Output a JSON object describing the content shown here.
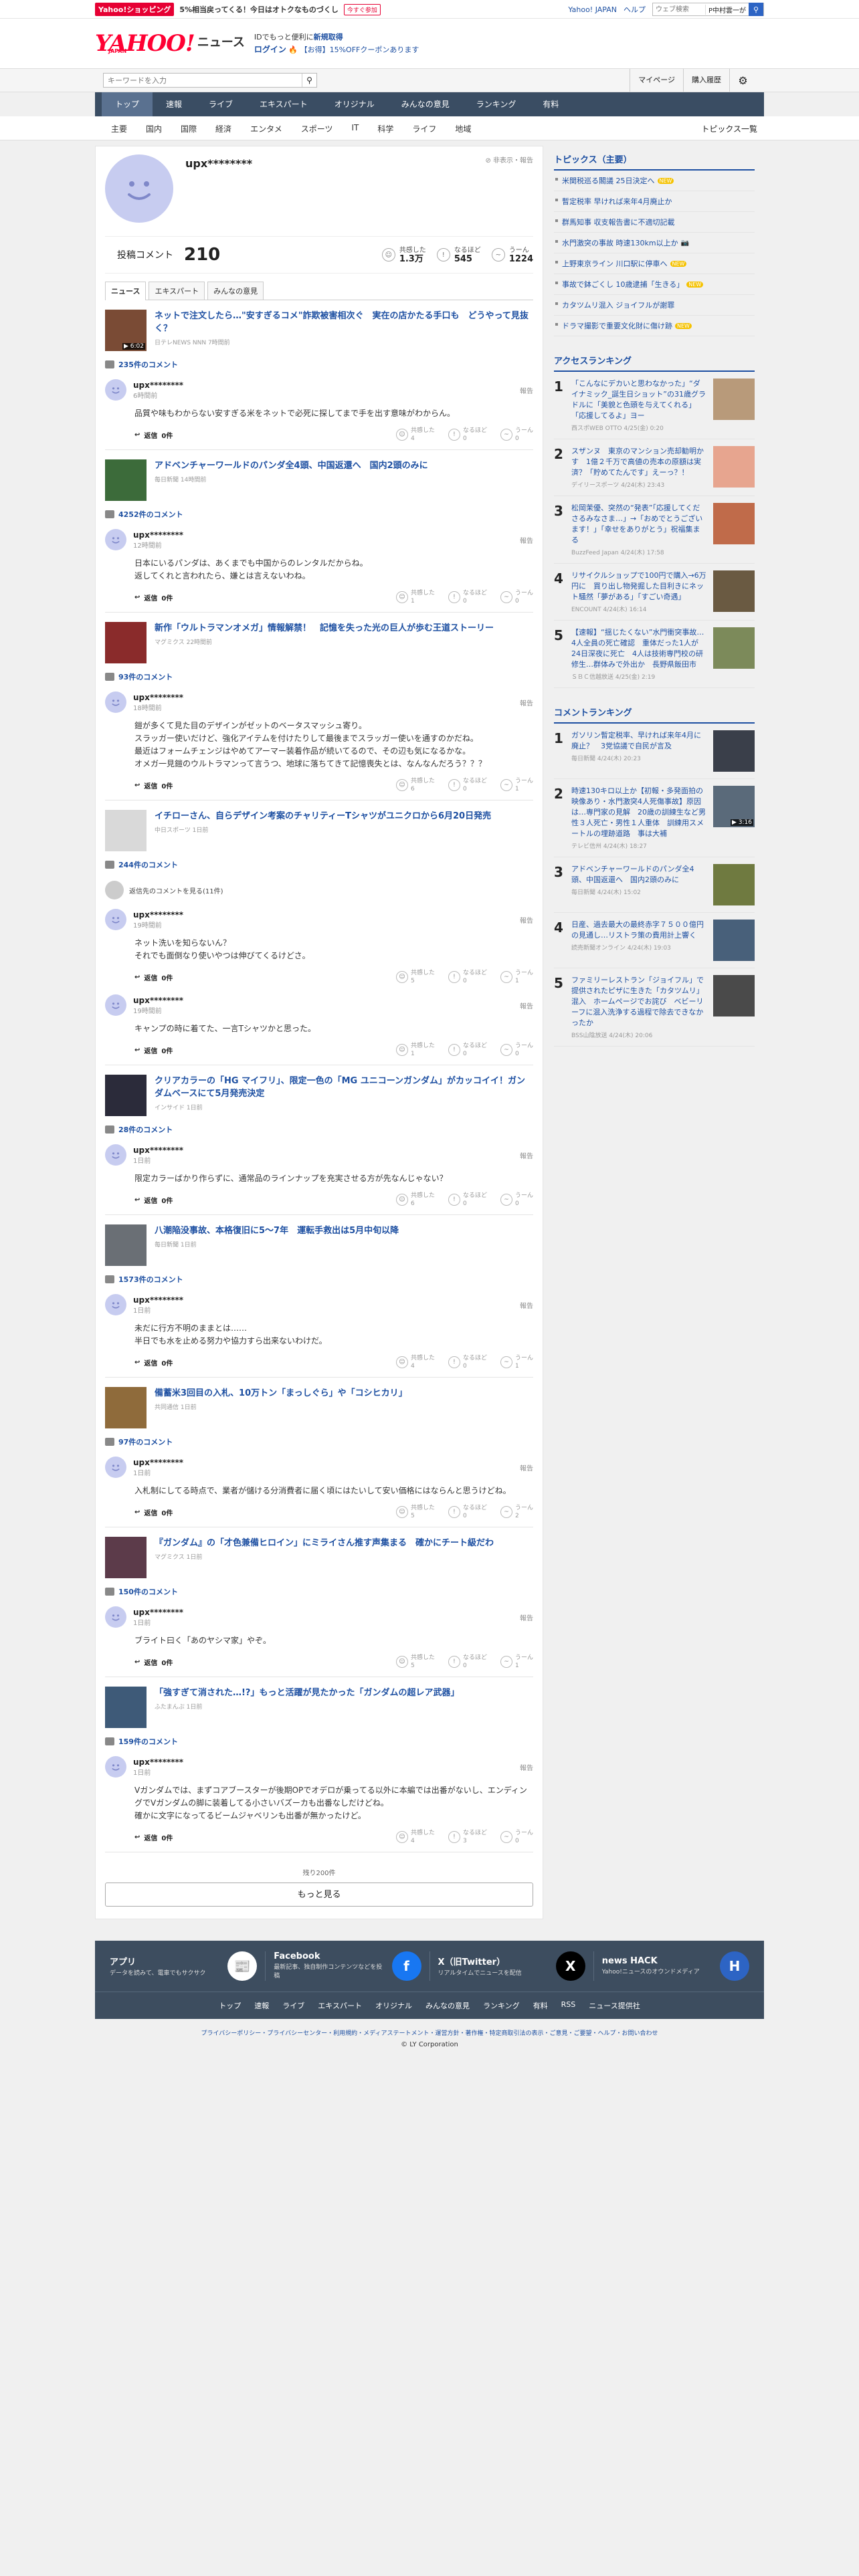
{
  "topbar": {
    "shop_badge": "Yahoo!ショッピング",
    "promo": "5%相当戻ってくる！今日はオトクなものづくし",
    "promo_button": "今すぐ参加",
    "yahoo_japan": "Yahoo! JAPAN",
    "help": "ヘルプ",
    "web_search_placeholder": "ウェブ検索",
    "web_search_chip": "P中村雲一が",
    "web_search_button": "検索"
  },
  "header": {
    "logo_text": "YAHOO!",
    "logo_sub": "JAPAN",
    "logo_news": "ニュース",
    "line1_prefix": "IDでもっと便利に",
    "line1_link": "新規取得",
    "line2_login": "ログイン",
    "line2_coupon": "【お得】15%OFFクーポンあります"
  },
  "searchrow": {
    "placeholder": "キーワードを入力",
    "mypage": "マイページ",
    "history": "購入履歴"
  },
  "mainnav": [
    "トップ",
    "速報",
    "ライブ",
    "エキスパート",
    "オリジナル",
    "みんなの意見",
    "ランキング",
    "有料"
  ],
  "subnav": [
    "主要",
    "国内",
    "国際",
    "経済",
    "エンタメ",
    "スポーツ",
    "IT",
    "科学",
    "ライフ",
    "地域"
  ],
  "subnav_right": "トピックス一覧",
  "profile": {
    "name": "upx********",
    "report": "非表示・報告",
    "post_label": "投稿コメント",
    "post_count": "210",
    "reactions": [
      {
        "label": "共感した",
        "value": "1.3万"
      },
      {
        "label": "なるほど",
        "value": "545"
      },
      {
        "label": "うーん",
        "value": "1224"
      }
    ],
    "tabs": [
      "ニュース",
      "エキスパート",
      "みんなの意見"
    ]
  },
  "articles": [
    {
      "title": "ネットで注文したら…\"安すぎるコメ\"詐欺被害相次ぐ　実在の店かたる手口も　どうやって見抜く？",
      "source": "日テレNEWS NNN 7時間前",
      "duration": "▶ 6:02",
      "comment_count": "235件のコメント",
      "comments": [
        {
          "user": "upx********",
          "time": "6時間前",
          "body": "品質や味もわからない安すぎる米をネットで必死に探してまで手を出す意味がわからん。",
          "votes": [
            "4",
            "0",
            "0"
          ]
        }
      ]
    },
    {
      "title": "アドベンチャーワールドのパンダ全4頭、中国返還へ　国内2頭のみに",
      "source": "毎日新聞 14時間前",
      "comment_count": "4252件のコメント",
      "comments": [
        {
          "user": "upx********",
          "time": "12時間前",
          "body": "日本にいるパンダは、あくまでも中国からのレンタルだからね。\n返してくれと言われたら、嫌とは言えないわね。",
          "votes": [
            "1",
            "0",
            "0"
          ]
        }
      ]
    },
    {
      "title": "新作「ウルトラマンオメガ」情報解禁！　記憶を失った光の巨人が歩む王道ストーリー",
      "source": "マグミクス 22時間前",
      "comment_count": "93件のコメント",
      "comments": [
        {
          "user": "upx********",
          "time": "18時間前",
          "body": "鎧が多くて見た目のデザインがゼットのベータスマッシュ寄り。\nスラッガー使いだけど、強化アイテムを付けたりして最後までスラッガー使いを通すのかだね。\n最近はフォームチェンジはやめてアーマー装着作品が続いてるので、その辺も気になるかな。\nオメガ一見鎧のウルトラマンって言うつ、地球に落ちてきて記憶喪失とは、なんなんだろう？？？",
          "votes": [
            "6",
            "0",
            "1"
          ]
        }
      ]
    },
    {
      "title": "イチローさん、自らデザイン考案のチャリティーTシャツがユニクロから6月20日発売",
      "source": "中日スポーツ 1日前",
      "comment_count": "244件のコメント",
      "hidden": "返信先のコメントを見る(11件)",
      "comments": [
        {
          "user": "upx********",
          "time": "19時間前",
          "body": "ネット洗いを知らないん？\nそれでも面倒なり使いやつは伸びてくるけどさ。",
          "votes": [
            "5",
            "0",
            "1"
          ]
        },
        {
          "user": "upx********",
          "time": "19時間前",
          "body": "キャンプの時に着てた、一言Tシャツかと思った。",
          "votes": [
            "1",
            "0",
            "0"
          ]
        }
      ]
    },
    {
      "title": "クリアカラーの「HG マイフリ」、限定一色の「MG ユニコーンガンダム」がカッコイイ！ガンダムベースにて5月発売決定",
      "source": "インサイド 1日前",
      "comment_count": "28件のコメント",
      "comments": [
        {
          "user": "upx********",
          "time": "1日前",
          "body": "限定カラーばかり作らずに、通常品のラインナップを充実させる方が先なんじゃない？",
          "votes": [
            "6",
            "0",
            "0"
          ]
        }
      ]
    },
    {
      "title": "八潮陥没事故、本格復旧に5～7年　運転手救出は5月中旬以降",
      "source": "毎日新聞 1日前",
      "comment_count": "1573件のコメント",
      "comments": [
        {
          "user": "upx********",
          "time": "1日前",
          "body": "未だに行方不明のままとは……\n半日でも水を止める努力や協力すら出来ないわけだ。",
          "votes": [
            "4",
            "0",
            "1"
          ]
        }
      ]
    },
    {
      "title": "備蓄米3回目の入札、10万トン「まっしぐら」や「コシヒカリ」",
      "source": "共同通信 1日前",
      "comment_count": "97件のコメント",
      "comments": [
        {
          "user": "upx********",
          "time": "1日前",
          "body": "入札制にしてる時点で、業者が儲ける分消費者に届く頃にはたいして安い価格にはならんと思うけどね。",
          "votes": [
            "5",
            "0",
            "2"
          ]
        }
      ]
    },
    {
      "title": "『ガンダム』の「才色兼備ヒロイン」にミライさん推す声集まる　確かにチート級だわ",
      "source": "マグミクス 1日前",
      "comment_count": "150件のコメント",
      "comments": [
        {
          "user": "upx********",
          "time": "1日前",
          "body": "ブライト曰く「あのヤシマ家」やぞ。",
          "votes": [
            "5",
            "0",
            "1"
          ]
        }
      ]
    },
    {
      "title": "「強すぎて消された…!?」もっと活躍が見たかった「ガンダムの超レア武器」",
      "source": "ふたまんぷ 1日前",
      "comment_count": "159件のコメント",
      "comments": [
        {
          "user": "upx********",
          "time": "1日前",
          "body": "Vガンダムでは、まずコアブースターが後期OPでオデロが乗ってる以外に本編では出番がないし、エンディングでVガンダムの脚に装着してる小さいバズーカも出番なしだけどね。\n確かに文字になってるビームジャベリンも出番が無かったけど。",
          "votes": [
            "4",
            "3",
            "0"
          ]
        }
      ]
    }
  ],
  "reply_label": "返信",
  "reply_count": "0件",
  "vote_labels": [
    "共感した",
    "なるほど",
    "うーん"
  ],
  "report_label": "報告",
  "remain": "残り200件",
  "more_button": "もっと見る",
  "sidebar": {
    "topics_title": "トピックス（主要）",
    "topics": [
      {
        "text": "米関税巡る閣議 25日決定へ",
        "new": "NEW"
      },
      {
        "text": "暫定税率 早ければ来年4月廃止か",
        "new": ""
      },
      {
        "text": "群馬知事 収支報告書に不適切記載",
        "new": ""
      },
      {
        "text": "水門激突の事故 時速130km以上か",
        "new": "",
        "cam": "📷"
      },
      {
        "text": "上野東京ライン 川口駅に停車へ",
        "new": "NEW"
      },
      {
        "text": "事故で鉢ごくし 10歳逮捕「生きる」",
        "new": "NEW"
      },
      {
        "text": "カタツムリ混入 ジョイフルが謝罪",
        "new": ""
      },
      {
        "text": "ドラマ撮影で重要文化財に傷け跡",
        "new": "NEW"
      }
    ],
    "access_title": "アクセスランキング",
    "access": [
      {
        "n": "1",
        "t": "「こんなにデカいと思わなかった」“ダイナミック_誕生日ショット”の31歳グラドルに「美貌と色頭を与えてくれる」「応援してるよ」ヨー",
        "s": "西スポWEB OTTO 4/25(金) 0:20"
      },
      {
        "n": "2",
        "t": "スザンヌ　東京のマンション売却勧明かす　1億２千万で高値の売本の原額は実済？「貯めてたんです」えーっ？！",
        "s": "デイリースポーツ 4/24(木) 23:43"
      },
      {
        "n": "3",
        "t": "松岡茉優、突然の“発表”「応援してくださるみなさま…」→「おめでとうございます！」「幸せをありがとう」祝福集まる",
        "s": "BuzzFeed Japan 4/24(木) 17:58"
      },
      {
        "n": "4",
        "t": "リサイクルショップで100円で購入→6万円に　買り出し物発掘した目利きにネット騒然「夢がある」「すごい奇遇」",
        "s": "ENCOUNT 4/24(木) 16:14"
      },
      {
        "n": "5",
        "t": "【速報】“揺じたくない”水門衝突事故…4人全員の死亡確認　重体だった1人が24日深夜に死亡　4人は技術専門校の研修生…群体みで外出か　長野県飯田市",
        "s": "ＳＢＣ信越放送 4/25(金) 2:19"
      }
    ],
    "comment_title": "コメントランキング",
    "comment_rank": [
      {
        "n": "1",
        "t": "ガソリン暫定税率、早ければ来年4月に廃止？　3党協議で自民が言及",
        "s": "毎日新聞 4/24(木) 20:23"
      },
      {
        "n": "2",
        "t": "時速130キロ以上か【初報・多発面拍の映像あり・水門激突4人死傷事故】原因は…専門家の見解　20歳の訓練生など男性３人死亡・男性１人重体　訓練用スメートルの埋跡道路　事は大補",
        "s": "テレビ信州 4/24(木) 18:27",
        "d": "▶ 3:16"
      },
      {
        "n": "3",
        "t": "アドベンチャーワールドのパンダ全4頭、中国返還へ　国内2頭のみに",
        "s": "毎日新聞 4/24(木) 15:02"
      },
      {
        "n": "4",
        "t": "日産、過去最大の最終赤字７５００億円の見通し…リストラ策の費用計上響く",
        "s": "読売新聞オンライン 4/24(木) 19:03"
      },
      {
        "n": "5",
        "t": "ファミリーレストラン「ジョイフル」で提供されたピザに生きた「カタツムリ」混入　ホームページでお詫び　ベビーリーフに混入洗浄する過程で除去できなかったか",
        "s": "BSS山陰放送 4/24(木) 20:06"
      }
    ]
  },
  "footer": {
    "apps": [
      {
        "t": "アプリ",
        "d": "データを読みて、電車でもサクサク",
        "ic": "📰"
      },
      {
        "t": "Facebook",
        "d": "最新記事、独自制作コンテンツなどを投稿",
        "ic": "f"
      },
      {
        "t": "X（旧Twitter）",
        "d": "リアルタイムでニュースを配信",
        "ic": "X"
      },
      {
        "t": "news HACK",
        "d": "Yahoo!ニュースのオウンドメディア",
        "ic": "H"
      }
    ],
    "links": [
      "トップ",
      "速報",
      "ライブ",
      "エキスパート",
      "オリジナル",
      "みんなの意見",
      "ランキング",
      "有料",
      "RSS",
      "ニュース提供社"
    ],
    "legal": "プライバシーポリシー・プライバシーセンター・利用規約・メディアステートメント・運営方針・著作権・特定商取引法の表示・ご意見・ご要望・ヘルプ・お問い合わせ",
    "copyright": "© LY Corporation"
  }
}
